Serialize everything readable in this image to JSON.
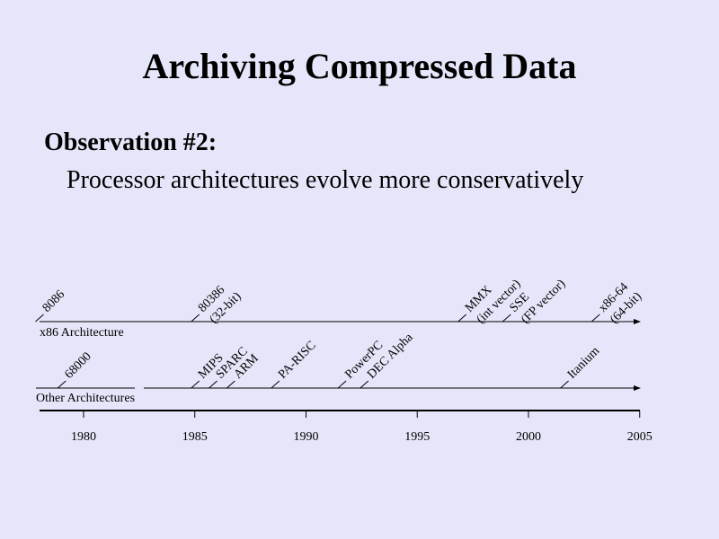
{
  "title": "Archiving Compressed Data",
  "observation": {
    "heading": "Observation #2:",
    "text": "Processor architectures evolve more conservatively"
  },
  "timeline": {
    "year_ticks": [
      "1980",
      "1985",
      "1990",
      "1995",
      "2000",
      "2005"
    ],
    "x86": {
      "label": "x86 Architecture",
      "events": [
        {
          "year": 1978,
          "lines": [
            "8086"
          ]
        },
        {
          "year": 1985,
          "lines": [
            "80386",
            "(32-bit)"
          ]
        },
        {
          "year": 1997,
          "lines": [
            "MMX",
            "(int vector)"
          ]
        },
        {
          "year": 1999,
          "lines": [
            "SSE",
            "(FP vector)"
          ]
        },
        {
          "year": 2003,
          "lines": [
            "x86-64",
            "(64-bit)"
          ]
        }
      ]
    },
    "other": {
      "label": "Other Architectures",
      "events": [
        {
          "year": 1979,
          "lines": [
            "68000"
          ]
        },
        {
          "year": 1985,
          "lines": [
            "MIPS"
          ]
        },
        {
          "year": 1985.8,
          "lines": [
            "SPARC"
          ]
        },
        {
          "year": 1986.6,
          "lines": [
            "ARM"
          ]
        },
        {
          "year": 1988.6,
          "lines": [
            "PA-RISC"
          ]
        },
        {
          "year": 1991.6,
          "lines": [
            "PowerPC"
          ]
        },
        {
          "year": 1992.6,
          "lines": [
            "DEC Alpha"
          ]
        },
        {
          "year": 2001.6,
          "lines": [
            "Itanium"
          ]
        }
      ]
    }
  }
}
